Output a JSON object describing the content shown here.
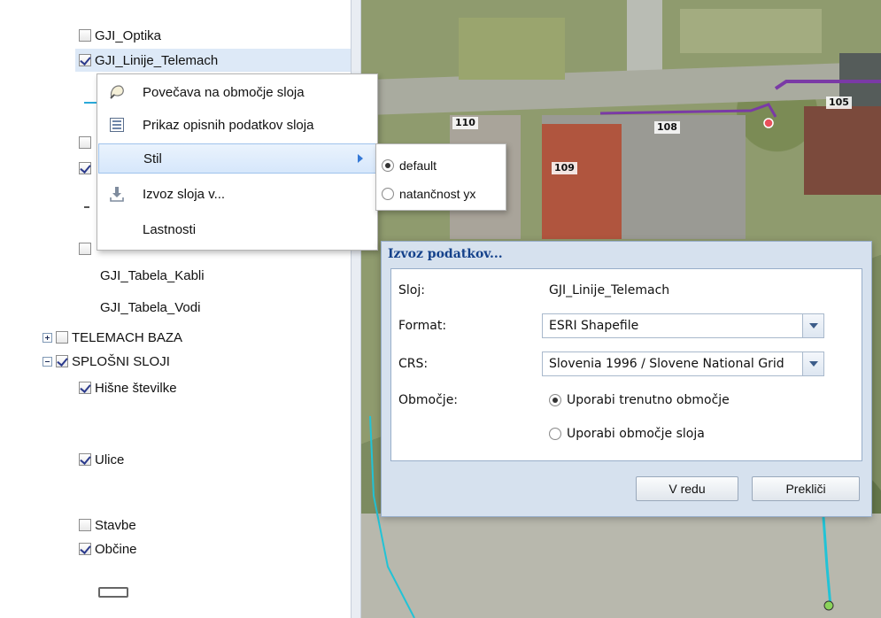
{
  "tree": {
    "items": [
      {
        "label": "GJI_Optika",
        "checked": false
      },
      {
        "label": "GJI_Linije_Telemach",
        "checked": true
      },
      {
        "label": "",
        "checked": false
      },
      {
        "label": "",
        "checked": true
      },
      {
        "label": "",
        "checked": false
      },
      {
        "label": "GJI_Tabela_Kabli"
      },
      {
        "label": "GJI_Tabela_Vodi"
      },
      {
        "label": "TELEMACH BAZA",
        "checked": false,
        "expander": "plus"
      },
      {
        "label": "SPLOŠNI SLOJI",
        "checked": true,
        "expander": "minus"
      },
      {
        "label": "Hišne številke",
        "checked": true
      },
      {
        "label": "Ulice",
        "checked": true
      },
      {
        "label": "Stavbe",
        "checked": false
      },
      {
        "label": "Občine",
        "checked": true
      }
    ]
  },
  "context_menu": {
    "items": [
      {
        "label": "Povečava na območje sloja",
        "icon": "zoom-to-layer-icon"
      },
      {
        "label": "Prikaz opisnih podatkov sloja",
        "icon": "attribute-table-icon"
      },
      {
        "label": "Stil",
        "icon": ""
      },
      {
        "label": "Izvoz sloja v...",
        "icon": "export-download-icon"
      },
      {
        "label": "Lastnosti",
        "icon": ""
      }
    ],
    "style_submenu": [
      {
        "label": "default",
        "selected": true
      },
      {
        "label": "natančnost yx",
        "selected": false
      }
    ]
  },
  "map": {
    "house_numbers": [
      "110",
      "108",
      "109",
      "105"
    ],
    "colors": {
      "line_purple": "#7a3aa6",
      "line_cyan": "#22c3d6",
      "node_red": "#e8505b"
    }
  },
  "dialog": {
    "title": "Izvoz podatkov...",
    "layer_label": "Sloj:",
    "layer_value": "GJI_Linije_Telemach",
    "format_label": "Format:",
    "format_value": "ESRI Shapefile",
    "crs_label": "CRS:",
    "crs_value": "Slovenia 1996 / Slovene National Grid",
    "area_label": "Območje:",
    "area_options": [
      {
        "label": "Uporabi trenutno območje",
        "selected": true
      },
      {
        "label": "Uporabi območje sloja",
        "selected": false
      }
    ],
    "ok_label": "V redu",
    "cancel_label": "Prekliči"
  }
}
